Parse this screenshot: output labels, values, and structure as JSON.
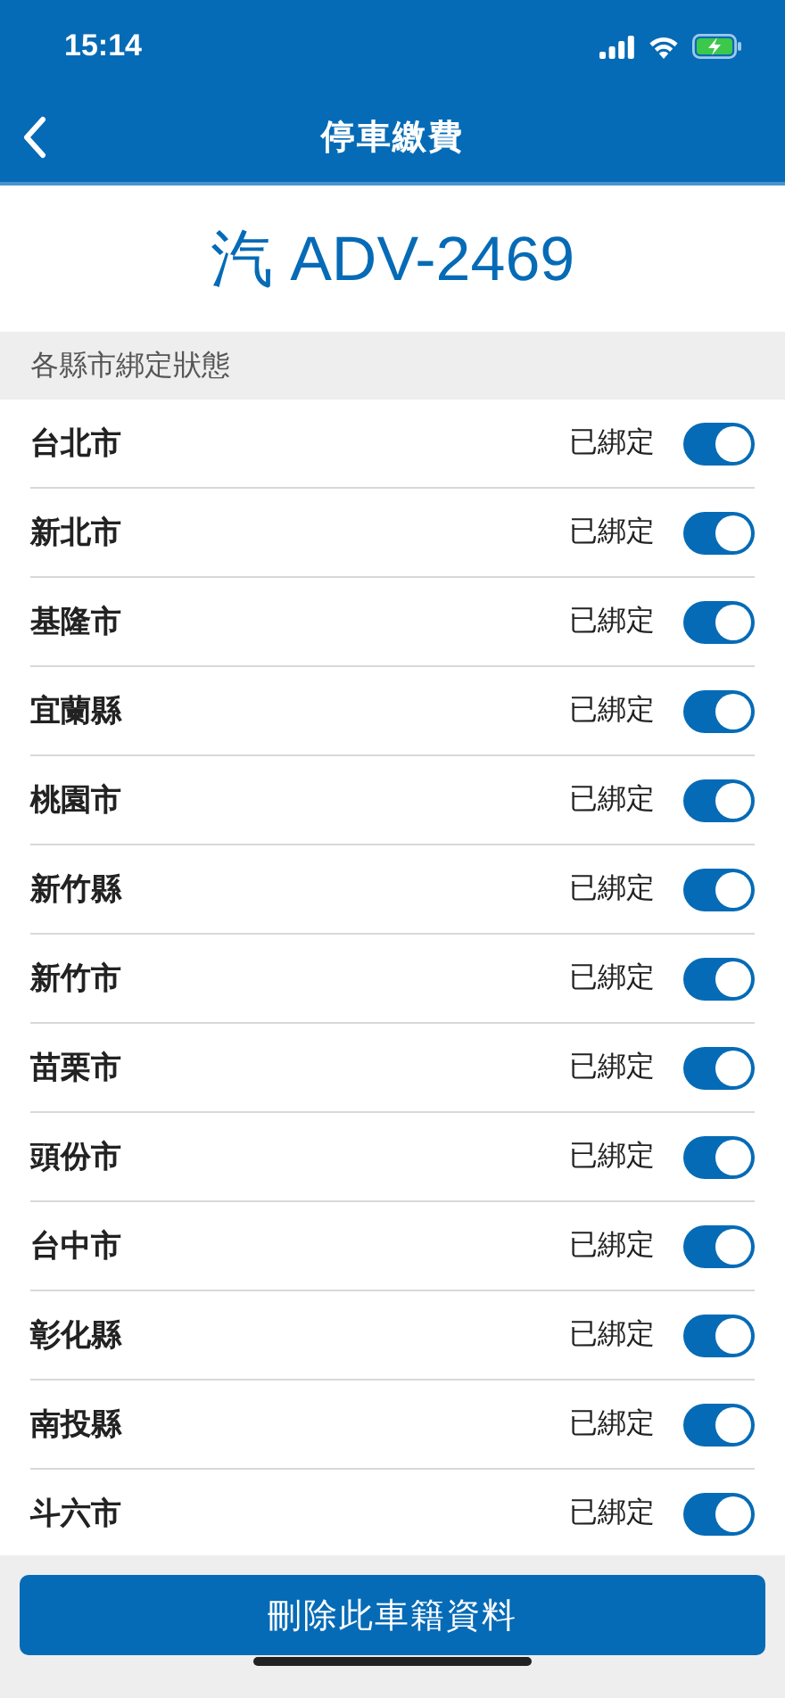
{
  "status_bar": {
    "time": "15:14"
  },
  "nav_bar": {
    "title": "停車繳費"
  },
  "plate": "汽 ADV-2469",
  "section_header": "各縣市綁定狀態",
  "cities": [
    {
      "name": "台北市",
      "status": "已綁定",
      "on": true
    },
    {
      "name": "新北市",
      "status": "已綁定",
      "on": true
    },
    {
      "name": "基隆市",
      "status": "已綁定",
      "on": true
    },
    {
      "name": "宜蘭縣",
      "status": "已綁定",
      "on": true
    },
    {
      "name": "桃園市",
      "status": "已綁定",
      "on": true
    },
    {
      "name": "新竹縣",
      "status": "已綁定",
      "on": true
    },
    {
      "name": "新竹市",
      "status": "已綁定",
      "on": true
    },
    {
      "name": "苗栗市",
      "status": "已綁定",
      "on": true
    },
    {
      "name": "頭份市",
      "status": "已綁定",
      "on": true
    },
    {
      "name": "台中市",
      "status": "已綁定",
      "on": true
    },
    {
      "name": "彰化縣",
      "status": "已綁定",
      "on": true
    },
    {
      "name": "南投縣",
      "status": "已綁定",
      "on": true
    },
    {
      "name": "斗六市",
      "status": "已綁定",
      "on": true
    }
  ],
  "delete_button": "刪除此車籍資料"
}
